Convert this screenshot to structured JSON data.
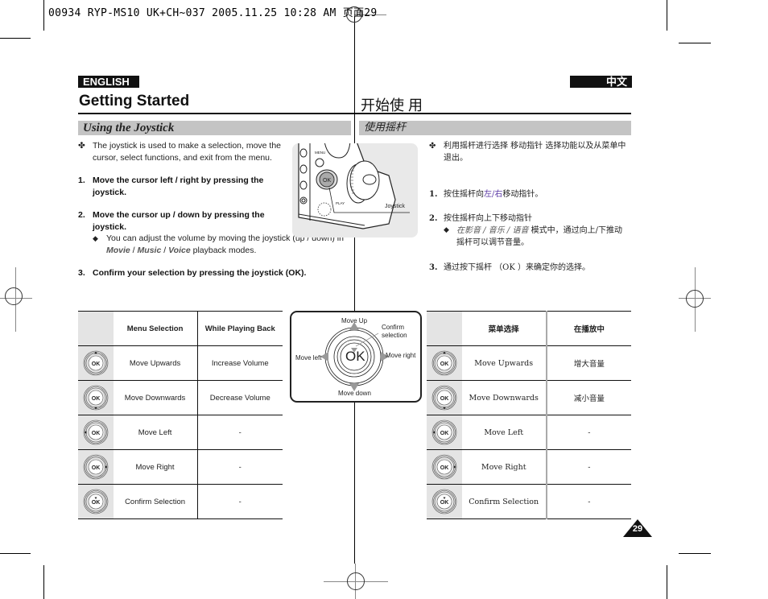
{
  "slug": {
    "text": "00934 RYP-MS10 UK+CH~037  2005.11.25 10:28 AM  页面29"
  },
  "english": {
    "lang_badge": "ENGLISH",
    "title": "Getting Started",
    "section": "Using the Joystick",
    "intro": "The joystick is used to make a selection, move the cursor, select functions, and exit from the menu.",
    "steps": [
      {
        "num": "1.",
        "before": "Move the cursor ",
        "highlight": "left / right",
        "after": " by pressing the joystick."
      },
      {
        "num": "2.",
        "text": "Move the cursor up / down by pressing the joystick."
      },
      {
        "num": "3.",
        "text": "Confirm your selection by pressing the joystick (OK)."
      }
    ],
    "note": {
      "before": "You can adjust the volume by moving the joystick (up / down) in ",
      "mode1": "Movie",
      "sep1": " / ",
      "mode2": "Music",
      "sep2": " / ",
      "mode3": "Voice",
      "after": " playback modes."
    },
    "table": {
      "headers": [
        "Menu Selection",
        "While Playing Back"
      ],
      "rows": [
        {
          "icon": "joystick-up-icon",
          "menu": "Move Upwards",
          "playback": "Increase Volume"
        },
        {
          "icon": "joystick-down-icon",
          "menu": "Move Downwards",
          "playback": "Decrease Volume"
        },
        {
          "icon": "joystick-left-icon",
          "menu": "Move Left",
          "playback": "-"
        },
        {
          "icon": "joystick-right-icon",
          "menu": "Move Right",
          "playback": "-"
        },
        {
          "icon": "joystick-press-icon",
          "menu": "Confirm Selection",
          "playback": "-"
        }
      ]
    }
  },
  "illustration": {
    "menu_label": "MENU",
    "ok_label": "OK",
    "play_label": "PLAY",
    "callout": "Joystick"
  },
  "joystick_diagram": {
    "center": "OK",
    "up": "Move Up",
    "down": "Move down",
    "left": "Move left",
    "right": "Move right",
    "confirm_line1": "Confirm",
    "confirm_line2": "selection"
  },
  "chinese": {
    "lang_badge": "中文",
    "title": "开始使 用",
    "section": "使用摇杆",
    "intro": "利用摇杆进行选择 移动指针 选择功能以及从菜单中退出。",
    "steps": [
      {
        "num": "1.",
        "before": "按住摇杆向",
        "highlight": "左/右",
        "after": "移动指针。"
      },
      {
        "num": "2.",
        "text": "按住摇杆向上下移动指针"
      },
      {
        "num": "3.",
        "text": "通过按下摇杆 （OK ）来确定你的选择。"
      }
    ],
    "note": {
      "modes": "在影音 / 音乐 / 语音",
      "after": " 模式中，通过向上/下推动摇杆可以调节音量。"
    },
    "table": {
      "headers": [
        "菜单选择",
        "在播放中"
      ],
      "rows": [
        {
          "icon": "joystick-up-icon",
          "menu": "Move Upwards",
          "playback": "增大音量"
        },
        {
          "icon": "joystick-down-icon",
          "menu": "Move Downwards",
          "playback": "减小音量"
        },
        {
          "icon": "joystick-left-icon",
          "menu": "Move Left",
          "playback": "-"
        },
        {
          "icon": "joystick-right-icon",
          "menu": "Move Right",
          "playback": "-"
        },
        {
          "icon": "joystick-press-icon",
          "menu": "Confirm Selection",
          "playback": "-"
        }
      ]
    }
  },
  "page_number": "29",
  "colors": {
    "highlight": "#5b3aa6",
    "section_bar": "#c4c4c4",
    "badge": "#111111"
  }
}
